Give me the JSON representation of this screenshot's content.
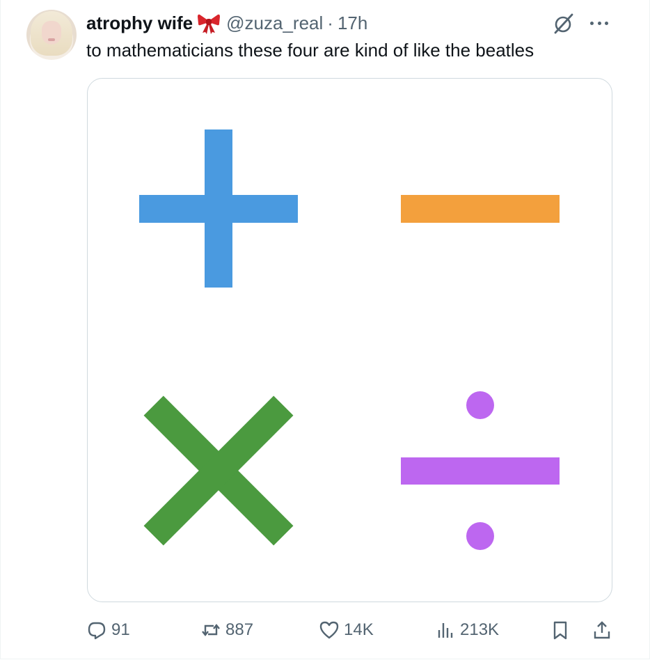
{
  "post": {
    "author": {
      "display_name": "atrophy wife",
      "name_emoji": "ribbon-icon",
      "handle": "@zuza_real",
      "separator": "·",
      "time": "17h"
    },
    "text": "to mathematicians these four are kind of like the beatles",
    "media": {
      "symbols": [
        {
          "name": "plus",
          "color": "#4a9ae0"
        },
        {
          "name": "minus",
          "color": "#f3a03d"
        },
        {
          "name": "multiply",
          "color": "#4b9a3f"
        },
        {
          "name": "divide",
          "color": "#bd67f0"
        }
      ]
    },
    "actions": {
      "replies": "91",
      "reposts": "887",
      "likes": "14K",
      "views": "213K"
    },
    "icons": {
      "reply": "reply-icon",
      "repost": "repost-icon",
      "like": "heart-icon",
      "views": "analytics-icon",
      "bookmark": "bookmark-icon",
      "share": "share-icon",
      "grok": "grok-icon",
      "more": "more-icon"
    },
    "colors": {
      "text_primary": "#0f1419",
      "text_secondary": "#536471",
      "border": "#cfd9de"
    }
  }
}
